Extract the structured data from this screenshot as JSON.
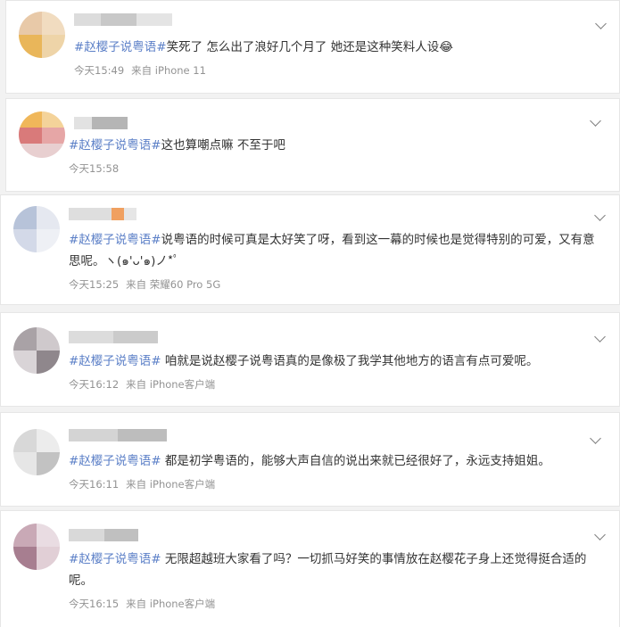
{
  "comments": [
    {
      "hashtag": "#赵樱子说粤语#",
      "text": "笑死了 怎么出了浪好几个月了 她还是这种笑料人设",
      "emoji": "😂",
      "time": "今天15:49",
      "source": "来自 iPhone 11"
    },
    {
      "hashtag": "#赵樱子说粤语#",
      "text": "这也算嘲点嘛 不至于吧",
      "emoji": "",
      "time": "今天15:58",
      "source": ""
    },
    {
      "hashtag": "#赵樱子说粤语#",
      "text": "说粤语的时候可真是太好笑了呀，看到这一幕的时候也是觉得特别的可爱，又有意思呢。ヽ(๑'ᴗ'๑)ノ*ﾟ",
      "emoji": "",
      "time": "今天15:25",
      "source": "来自 荣耀60 Pro 5G"
    },
    {
      "hashtag": "#赵樱子说粤语#",
      "text": " 咱就是说赵樱子说粤语真的是像极了我学其他地方的语言有点可爱呢。",
      "emoji": "",
      "time": "今天16:12",
      "source": "来自 iPhone客户端"
    },
    {
      "hashtag": "#赵樱子说粤语#",
      "text": " 都是初学粤语的，能够大声自信的说出来就已经很好了，永远支持姐姐。",
      "emoji": "",
      "time": "今天16:11",
      "source": "来自 iPhone客户端"
    },
    {
      "hashtag": "#赵樱子说粤语#",
      "text": " 无限超越班大家看了吗？一切抓马好笑的事情放在赵樱花子身上还觉得挺合适的呢。",
      "emoji": "",
      "time": "今天16:15",
      "source": "来自 iPhone客户端"
    }
  ],
  "colors": {
    "hashtag": "#5b7fc7",
    "text": "#333333",
    "meta": "#939393",
    "page_bg": "#f2f2f2"
  },
  "icons": {
    "expand": "chevron-down-icon",
    "emoji": "laughing-face-emoji"
  }
}
